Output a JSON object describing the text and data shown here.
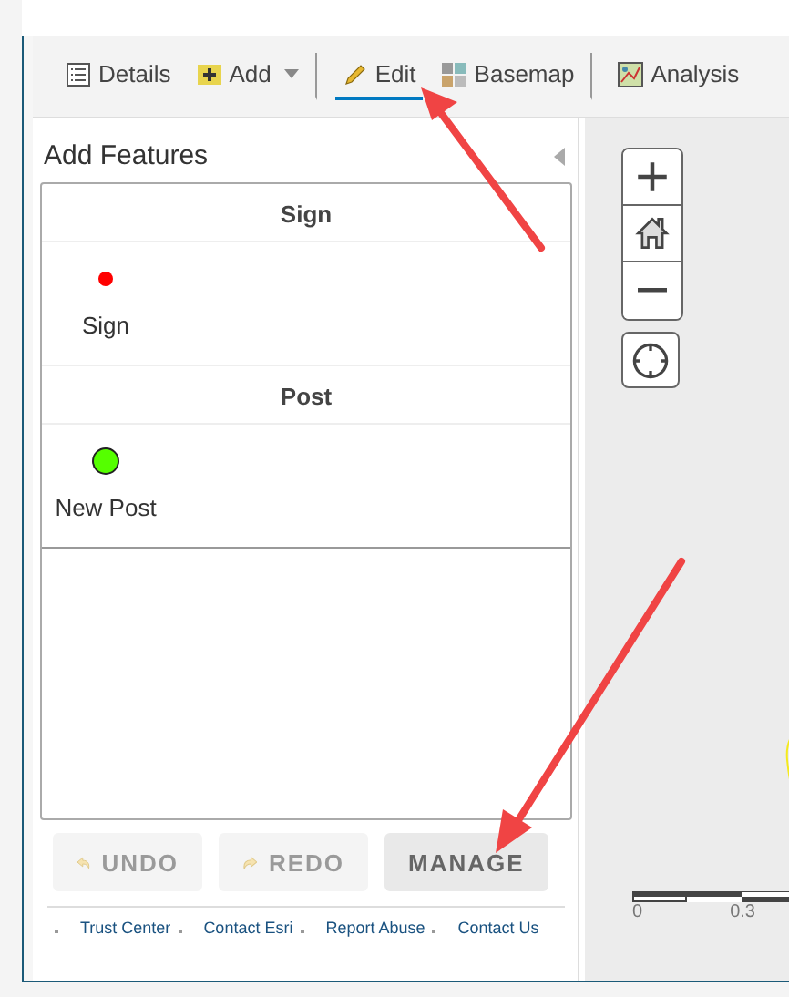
{
  "toolbar": {
    "tabs": [
      {
        "label": "Details",
        "kind": "details",
        "selected": false,
        "dropdown": false,
        "separator_after": false
      },
      {
        "label": "Add",
        "kind": "add",
        "selected": false,
        "dropdown": true,
        "separator_after": true
      },
      {
        "label": "Edit",
        "kind": "edit",
        "selected": true,
        "dropdown": false,
        "separator_after": false
      },
      {
        "label": "Basemap",
        "kind": "basemap",
        "selected": false,
        "dropdown": false,
        "separator_after": true
      },
      {
        "label": "Analysis",
        "kind": "analysis",
        "selected": false,
        "dropdown": false,
        "separator_after": false
      }
    ]
  },
  "panel": {
    "title": "Add Features",
    "groups": [
      {
        "name": "Sign",
        "templates": [
          {
            "label": "Sign",
            "color": "#ff0000",
            "kind": "dot"
          }
        ]
      },
      {
        "name": "Post",
        "templates": [
          {
            "label": "New Post",
            "color": "#55ff00",
            "kind": "circle"
          }
        ]
      }
    ],
    "buttons": [
      {
        "label": "UNDO",
        "kind": "undo",
        "disabled": true
      },
      {
        "label": "REDO",
        "kind": "redo",
        "disabled": true
      },
      {
        "label": "MANAGE",
        "kind": "plain",
        "disabled": false
      }
    ],
    "footer_links": [
      "Trust Center",
      "Contact Esri",
      "Report Abuse",
      "Contact Us"
    ]
  },
  "map": {
    "scale_labels": [
      "0",
      "0.3"
    ]
  }
}
